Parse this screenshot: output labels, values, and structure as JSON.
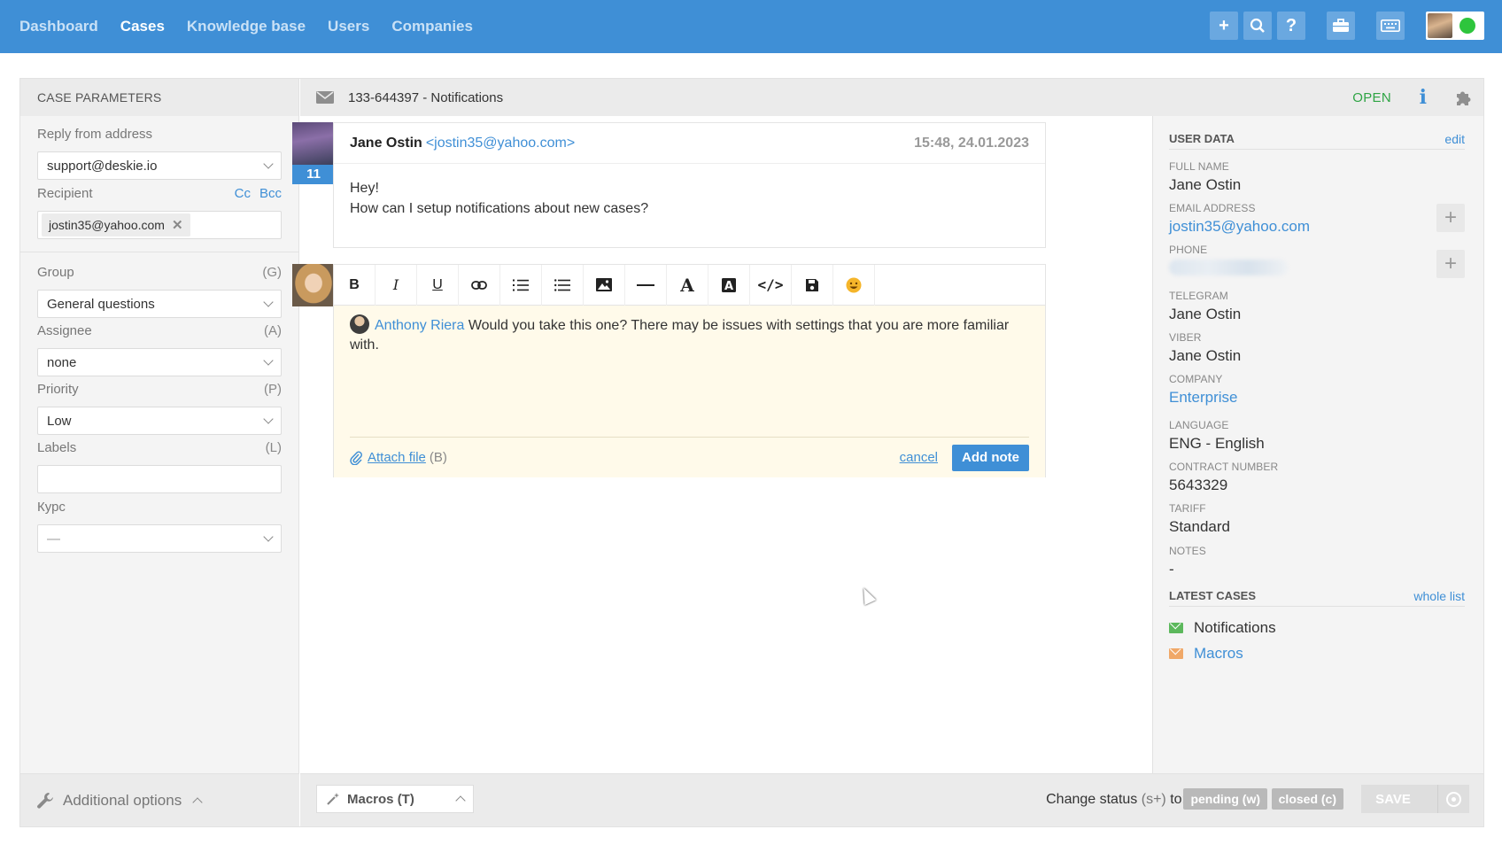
{
  "nav": {
    "items": [
      {
        "label": "Dashboard"
      },
      {
        "label": "Cases"
      },
      {
        "label": "Knowledge base"
      },
      {
        "label": "Users"
      },
      {
        "label": "Companies"
      }
    ],
    "active": "Cases",
    "icons": [
      "plus-icon",
      "search-icon",
      "help-icon",
      "briefcase-icon",
      "keyboard-icon"
    ],
    "status_color": "#2ec53d"
  },
  "case_params": {
    "title": "CASE PARAMETERS",
    "reply_from_label": "Reply from address",
    "reply_from_value": "support@deskie.io",
    "recipient_label": "Recipient",
    "cc": "Cc",
    "bcc": "Bcc",
    "recipient_chip": "jostin35@yahoo.com",
    "group_label": "Group",
    "group_hotkey": "(G)",
    "group_value": "General questions",
    "assignee_label": "Assignee",
    "assignee_hotkey": "(A)",
    "assignee_value": "none",
    "priority_label": "Priority",
    "priority_hotkey": "(P)",
    "priority_value": "Low",
    "labels_label": "Labels",
    "labels_hotkey": "(L)",
    "kypc_label": "Курс",
    "kypc_value": "—",
    "additional_options": "Additional options"
  },
  "case": {
    "id_title": "133-644397 - Notifications",
    "status": "OPEN"
  },
  "message": {
    "count": "11",
    "sender_name": "Jane Ostin",
    "sender_email": "<jostin35@yahoo.com>",
    "time": "15:48, 24.01.2023",
    "line1": "Hey!",
    "line2": "How can I setup notifications about new cases?"
  },
  "editor": {
    "tools": [
      "bold-icon",
      "italic-icon",
      "underline-icon",
      "link-icon",
      "ordered-list-icon",
      "bullet-list-icon",
      "image-icon",
      "horizontal-rule-icon",
      "font-color-icon",
      "highlight-icon",
      "code-icon",
      "save-icon",
      "emoji-icon"
    ],
    "mention": "Anthony Riera",
    "note_text": " Would you take this one? There may be issues with settings that you are more familiar with.",
    "attach_label": "Attach file",
    "attach_hotkey": "(B)",
    "cancel_label": "cancel",
    "add_note_label": "Add note"
  },
  "footer": {
    "macros_label": "Macros (T)",
    "change_status_label": "Change status",
    "change_status_hotkey": "(s+)",
    "change_status_to": "to:",
    "pending_label": "pending (w)",
    "closed_label": "closed (c)",
    "save_label": "SAVE"
  },
  "user_data": {
    "title": "USER DATA",
    "edit": "edit",
    "full_name_label": "FULL NAME",
    "full_name": "Jane Ostin",
    "email_label": "EMAIL ADDRESS",
    "email": "jostin35@yahoo.com",
    "phone_label": "PHONE",
    "telegram_label": "TELEGRAM",
    "telegram": "Jane Ostin",
    "viber_label": "VIBER",
    "viber": "Jane Ostin",
    "company_label": "COMPANY",
    "company": "Enterprise",
    "language_label": "LANGUAGE",
    "language": "ENG - English",
    "contract_label": "CONTRACT NUMBER",
    "contract": "5643329",
    "tariff_label": "TARIFF",
    "tariff": "Standard",
    "notes_label": "NOTES",
    "notes": "-"
  },
  "latest_cases": {
    "title": "LATEST CASES",
    "whole_list": "whole list",
    "items": [
      {
        "label": "Notifications",
        "color": "#5cb85c"
      },
      {
        "label": "Macros",
        "color": "#f0a868"
      }
    ]
  }
}
